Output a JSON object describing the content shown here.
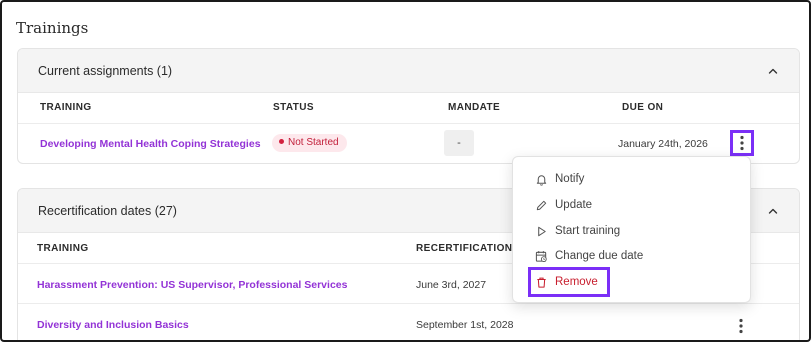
{
  "page": {
    "title": "Trainings"
  },
  "current": {
    "title": "Current assignments (1)",
    "columns": [
      "TRAINING",
      "STATUS",
      "MANDATE",
      "DUE ON"
    ],
    "rows": [
      {
        "training": "Developing Mental Health Coping Strategies",
        "status": "Not Started",
        "mandate": "-",
        "due_on": "January 24th, 2026"
      }
    ]
  },
  "recert": {
    "title": "Recertification dates (27)",
    "columns": [
      "TRAINING",
      "RECERTIFICATION D"
    ],
    "rows": [
      {
        "training": "Harassment Prevention: US Supervisor, Professional Services",
        "date": "June 3rd, 2027"
      },
      {
        "training": "Diversity and Inclusion Basics",
        "date": "September 1st, 2028"
      }
    ]
  },
  "menu": {
    "items": [
      {
        "label": "Notify",
        "icon": "bell-icon"
      },
      {
        "label": "Update",
        "icon": "pencil-icon"
      },
      {
        "label": "Start training",
        "icon": "play-icon"
      },
      {
        "label": "Change due date",
        "icon": "calendar-clock-icon"
      },
      {
        "label": "Remove",
        "icon": "trash-icon"
      }
    ]
  },
  "colors": {
    "accent": "#9333d6",
    "highlight": "#7b2ff7",
    "danger": "#c81e2e",
    "status_bg": "#fde8ec"
  }
}
